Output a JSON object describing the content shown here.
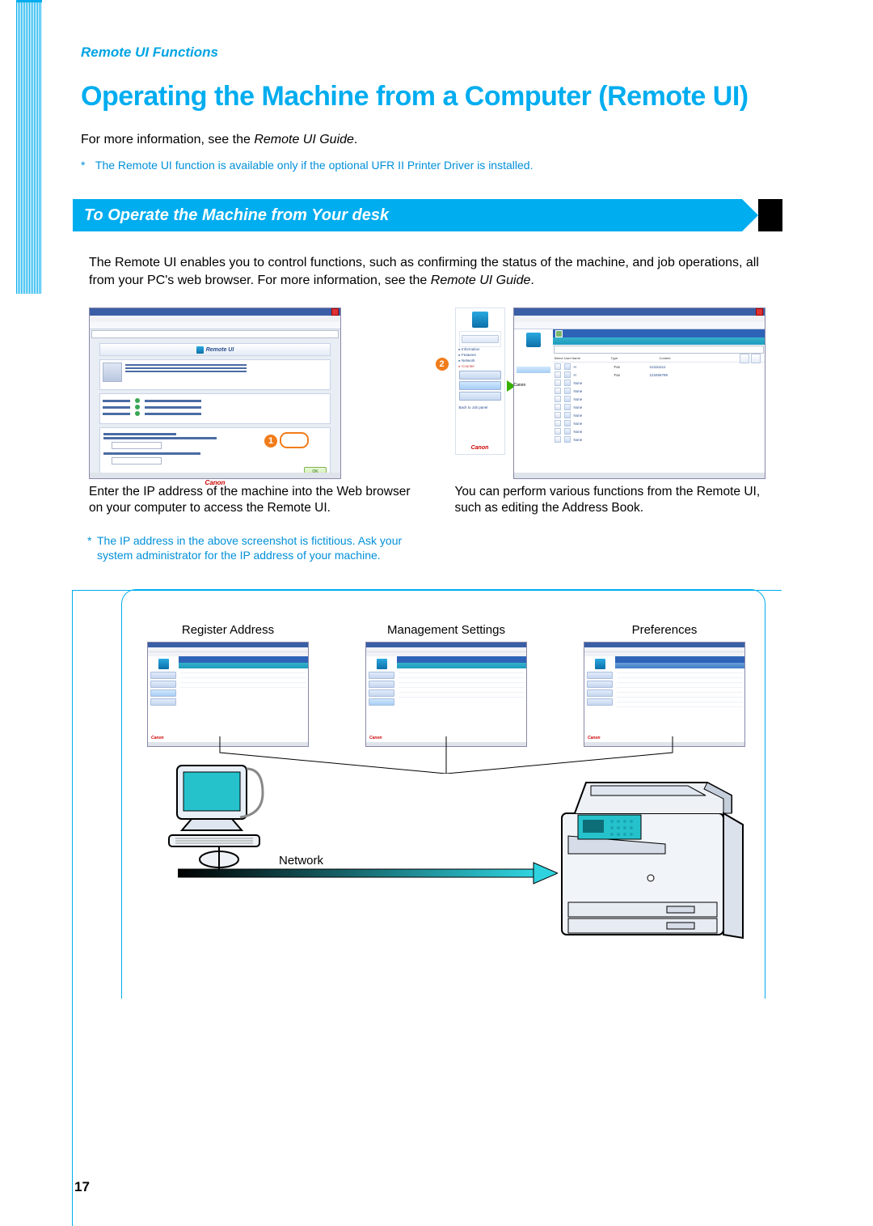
{
  "breadcrumb": "Remote UI Functions",
  "title": "Operating the Machine from a Computer (Remote UI)",
  "intro_prefix": "For more information, see the ",
  "intro_italic": "Remote UI Guide",
  "intro_suffix": ".",
  "note_top": "The Remote UI function is available only if the optional UFR II Printer Driver is installed.",
  "callout": "To Operate the Machine from Your desk",
  "desc_1": "The Remote UI enables you to control functions, such as confirming the status of the machine, and job operations, all from your PC's web browser. For more information, see the ",
  "desc_italic": "Remote UI Guide",
  "desc_suffix": ".",
  "shot1": {
    "banner": "Remote UI",
    "brand": "Canon",
    "ok": "OK"
  },
  "shot2": {
    "brand": "Canon"
  },
  "cap1": "Enter the IP address of the machine into the Web browser on your computer to access the Remote UI.",
  "cap2": "You can perform various functions from the Remote UI, such as editing the Address Book.",
  "note_ip": "The IP address in the above screenshot is fictitious. Ask your system administrator for the IP address of your machine.",
  "thumbs": {
    "t1": "Register Address",
    "t2": "Management Settings",
    "t3": "Preferences"
  },
  "network_label": "Network",
  "page_number": "17",
  "badges": {
    "one": "1",
    "two": "2"
  }
}
